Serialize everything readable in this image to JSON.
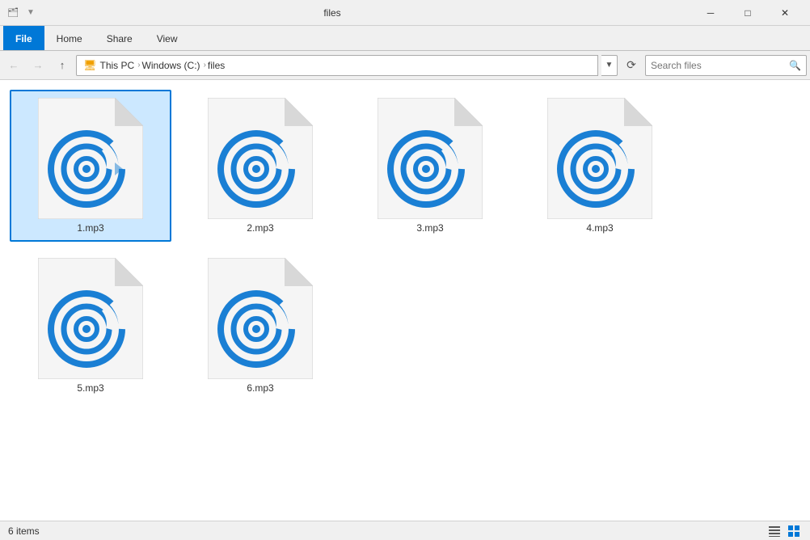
{
  "window": {
    "title": "files",
    "icons": {
      "quick_access": "📁",
      "back": "←",
      "forward": "→",
      "up": "↑"
    }
  },
  "titlebar": {
    "minimize": "─",
    "maximize": "□",
    "close": "✕",
    "help": "?"
  },
  "ribbon": {
    "tabs": [
      "File",
      "Home",
      "Share",
      "View"
    ],
    "active_tab": "File"
  },
  "addressbar": {
    "path_parts": [
      "This PC",
      "Windows (C:)",
      "files"
    ],
    "search_placeholder": "Search files",
    "search_label": "Search"
  },
  "files": [
    {
      "name": "1.mp3",
      "selected": true
    },
    {
      "name": "2.mp3",
      "selected": false
    },
    {
      "name": "3.mp3",
      "selected": false
    },
    {
      "name": "4.mp3",
      "selected": false
    },
    {
      "name": "5.mp3",
      "selected": false
    },
    {
      "name": "6.mp3",
      "selected": false
    }
  ],
  "statusbar": {
    "count": "6 items"
  },
  "colors": {
    "accent": "#0078d7",
    "icon_blue": "#1a7fd4"
  }
}
